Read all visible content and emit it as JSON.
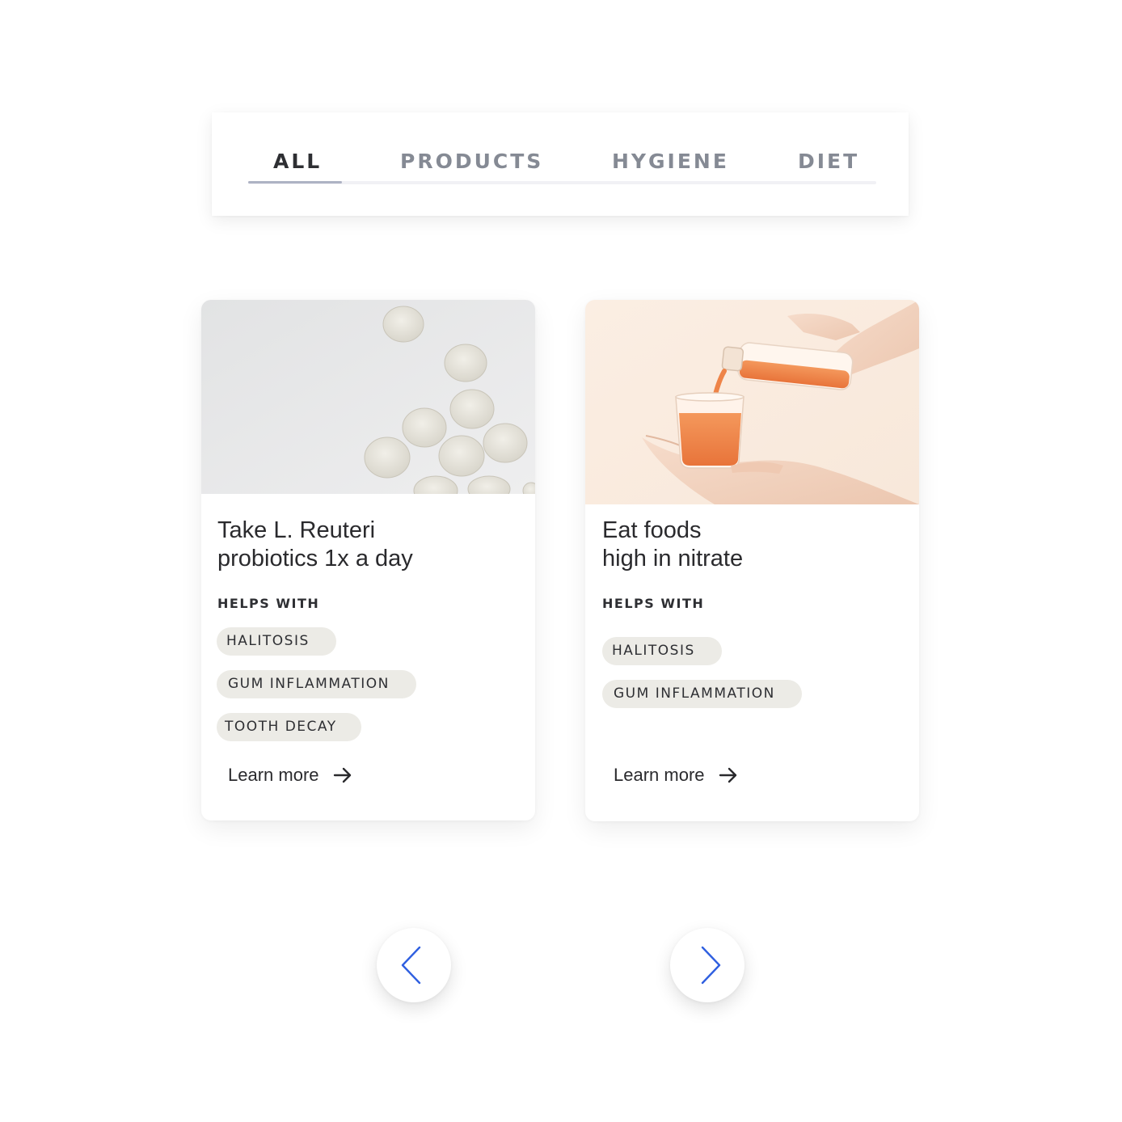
{
  "tabs": [
    {
      "label": "ALL",
      "active": true
    },
    {
      "label": "PRODUCTS",
      "active": false
    },
    {
      "label": "HYGIENE",
      "active": false
    },
    {
      "label": "DIET",
      "active": false
    }
  ],
  "cards": [
    {
      "image": "probiotic-tablets-image",
      "title": "Take L. Reuteri\nprobiotics 1x a day",
      "helps_label": "HELPS WITH",
      "chips": [
        "HALITOSIS",
        "GUM INFLAMMATION",
        "TOOTH DECAY"
      ],
      "link_label": "Learn more"
    },
    {
      "image": "juice-pouring-image",
      "title": "Eat foods\nhigh in nitrate",
      "helps_label": "HELPS WITH",
      "chips": [
        "HALITOSIS",
        "GUM INFLAMMATION"
      ],
      "link_label": "Learn more"
    }
  ],
  "navigation": {
    "prev_icon": "chevron-left-icon",
    "next_icon": "chevron-right-icon"
  },
  "colors": {
    "accent": "#2f5fe0",
    "chip_bg": "#ecebe6",
    "text_dark": "#2e2f33",
    "tab_inactive": "#858a94"
  }
}
